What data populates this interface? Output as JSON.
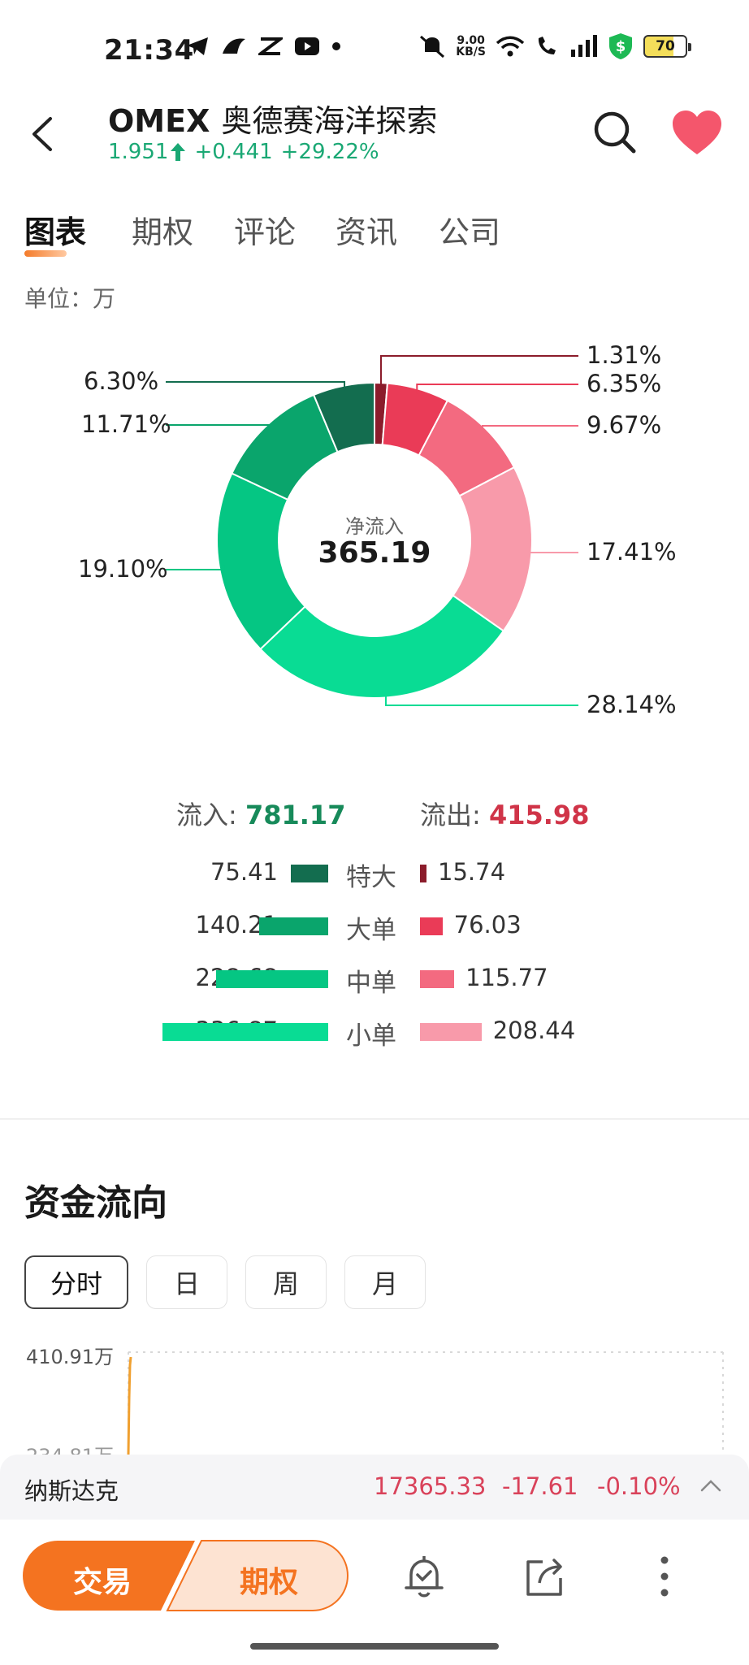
{
  "status_bar": {
    "time": "21:34",
    "net_speed_value": "9.00",
    "net_speed_unit": "KB/S",
    "battery": "70",
    "icons": [
      "telegram-icon",
      "bird-icon",
      "capcut-icon",
      "youtube-icon",
      "dot-icon",
      "mute-icon",
      "wifi-icon",
      "wifi-call-icon",
      "signal-icon",
      "money-shield-icon",
      "battery-icon"
    ]
  },
  "header": {
    "ticker": "OMEX",
    "company_name": "奥德赛海洋探索",
    "price": "1.951",
    "change": "+0.441",
    "change_pct": "+29.22%",
    "up_color": "#1aa874"
  },
  "tabs": [
    {
      "label": "图表",
      "active": true
    },
    {
      "label": "期权",
      "active": false
    },
    {
      "label": "评论",
      "active": false
    },
    {
      "label": "资讯",
      "active": false
    },
    {
      "label": "公司",
      "active": false
    }
  ],
  "unit_label": "单位：万",
  "chart_data": {
    "type": "pie",
    "style": "donut",
    "center_label": "净流入",
    "center_value": "365.19",
    "slices": [
      {
        "label": "1.31%",
        "value": 1.31,
        "color": "#8b1c2b"
      },
      {
        "label": "6.35%",
        "value": 6.35,
        "color": "#ea3b57"
      },
      {
        "label": "9.67%",
        "value": 9.67,
        "color": "#f36a80"
      },
      {
        "label": "17.41%",
        "value": 17.41,
        "color": "#f89aaa"
      },
      {
        "label": "28.14%",
        "value": 28.14,
        "color": "#09dc94"
      },
      {
        "label": "19.10%",
        "value": 19.1,
        "color": "#05c683"
      },
      {
        "label": "11.71%",
        "value": 11.71,
        "color": "#0aa56c"
      },
      {
        "label": "6.30%",
        "value": 6.3,
        "color": "#136d4f"
      }
    ]
  },
  "flows": {
    "inflow_label": "流入:",
    "inflow_value": "781.17",
    "outflow_label": "流出:",
    "outflow_value": "415.98",
    "rows": [
      {
        "category": "特大",
        "inflow": 75.41,
        "inflow_text": "75.41",
        "outflow": 15.74,
        "outflow_text": "15.74",
        "in_color": "#136d4f",
        "out_color": "#8b1c2b"
      },
      {
        "category": "大单",
        "inflow": 140.21,
        "inflow_text": "140.21",
        "outflow": 76.03,
        "outflow_text": "76.03",
        "in_color": "#0aa56c",
        "out_color": "#ea3b57"
      },
      {
        "category": "中单",
        "inflow": 228.68,
        "inflow_text": "228.68",
        "outflow": 115.77,
        "outflow_text": "115.77",
        "in_color": "#05c683",
        "out_color": "#f36a80"
      },
      {
        "category": "小单",
        "inflow": 336.87,
        "inflow_text": "336.87",
        "outflow": 208.44,
        "outflow_text": "208.44",
        "in_color": "#09dc94",
        "out_color": "#f89aaa"
      }
    ]
  },
  "money_flow": {
    "title": "资金流向",
    "periods": [
      {
        "label": "分时",
        "active": true
      },
      {
        "label": "日",
        "active": false
      },
      {
        "label": "周",
        "active": false
      },
      {
        "label": "月",
        "active": false
      }
    ],
    "y_top_label": "410.91万",
    "y_mid_label": "234.81万"
  },
  "index_bar": {
    "name": "纳斯达克",
    "value": "17365.33",
    "change": "-17.61",
    "change_pct": "-0.10%"
  },
  "bottom_bar": {
    "trade_label": "交易",
    "options_label": "期权",
    "accent": "#f47320"
  }
}
